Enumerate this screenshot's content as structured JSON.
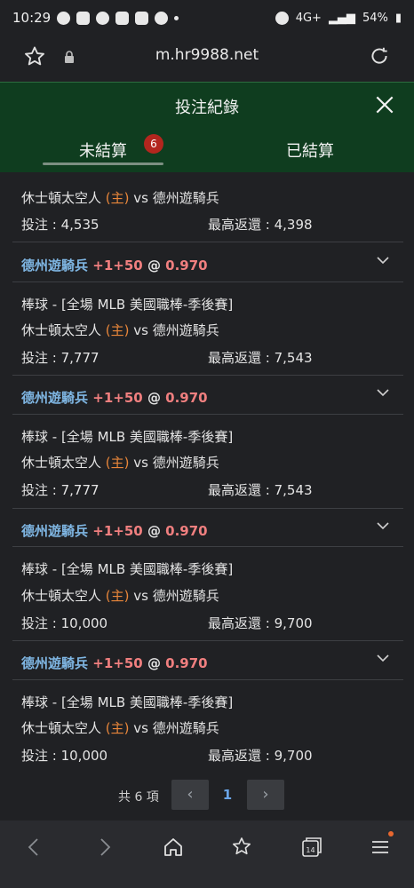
{
  "status": {
    "time": "10:29",
    "battery": "54%",
    "network": "4G+"
  },
  "browser": {
    "url": "m.hr9988.net"
  },
  "header": {
    "title": "投注紀錄"
  },
  "tabs": [
    {
      "label": "未結算",
      "badge": "6",
      "active": true
    },
    {
      "label": "已結算",
      "active": false
    }
  ],
  "records": [
    {
      "matchup": {
        "home": "休士頓太空人",
        "home_tag": "(主)",
        "vs": "vs",
        "away": "德州遊騎兵"
      },
      "stake": "投注 : 4,535",
      "max_return": "最高返還 : 4,398"
    },
    {
      "pick": {
        "team": "德州遊騎兵",
        "line": "+1+50",
        "at": "@",
        "odds": "0.970"
      },
      "league": "棒球 - [全場 MLB 美國職棒-季後賽]",
      "matchup": {
        "home": "休士頓太空人",
        "home_tag": "(主)",
        "vs": "vs",
        "away": "德州遊騎兵"
      },
      "stake": "投注 : 7,777",
      "max_return": "最高返還 : 7,543"
    },
    {
      "pick": {
        "team": "德州遊騎兵",
        "line": "+1+50",
        "at": "@",
        "odds": "0.970"
      },
      "league": "棒球 - [全場 MLB 美國職棒-季後賽]",
      "matchup": {
        "home": "休士頓太空人",
        "home_tag": "(主)",
        "vs": "vs",
        "away": "德州遊騎兵"
      },
      "stake": "投注 : 7,777",
      "max_return": "最高返還 : 7,543"
    },
    {
      "pick": {
        "team": "德州遊騎兵",
        "line": "+1+50",
        "at": "@",
        "odds": "0.970"
      },
      "league": "棒球 - [全場 MLB 美國職棒-季後賽]",
      "matchup": {
        "home": "休士頓太空人",
        "home_tag": "(主)",
        "vs": "vs",
        "away": "德州遊騎兵"
      },
      "stake": "投注 : 10,000",
      "max_return": "最高返還 : 9,700"
    },
    {
      "pick": {
        "team": "德州遊騎兵",
        "line": "+1+50",
        "at": "@",
        "odds": "0.970"
      },
      "league": "棒球 - [全場 MLB 美國職棒-季後賽]",
      "matchup": {
        "home": "休士頓太空人",
        "home_tag": "(主)",
        "vs": "vs",
        "away": "德州遊騎兵"
      },
      "stake": "投注 : 10,000",
      "max_return": "最高返還 : 9,700"
    }
  ],
  "pagination": {
    "total": "共 6 項",
    "prev": "‹",
    "current": "1",
    "next": "›"
  },
  "bottom_nav": {
    "tab_count": "14"
  },
  "colors": {
    "header_bg": "#0f3d1f",
    "team": "#7fb6e3",
    "odds": "#f07f7f",
    "home_tag": "#e8863a",
    "badge": "#b3261e"
  }
}
